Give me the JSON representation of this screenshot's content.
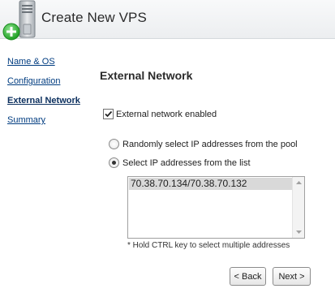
{
  "header": {
    "title": "Create New VPS",
    "icon": "server-add-icon"
  },
  "nav": {
    "items": [
      {
        "label": "Name & OS",
        "active": false
      },
      {
        "label": "Configuration",
        "active": false
      },
      {
        "label": "External Network",
        "active": true
      },
      {
        "label": "Summary",
        "active": false
      }
    ]
  },
  "main": {
    "section_title": "External Network",
    "external_enabled": {
      "label": "External network enabled",
      "checked": true
    },
    "radio_random": {
      "label": "Randomly select IP addresses from the pool",
      "selected": false
    },
    "radio_list": {
      "label": "Select IP addresses from the list",
      "selected": true
    },
    "ip_list": {
      "items": [
        "70.38.70.134/70.38.70.132"
      ]
    },
    "hint": "* Hold CTRL key to select multiple addresses"
  },
  "buttons": {
    "back": "< Back",
    "next": "Next >"
  },
  "colors": {
    "link": "#003c80",
    "selection": "#d9d9d9",
    "icon_green": "#2fb52f"
  }
}
